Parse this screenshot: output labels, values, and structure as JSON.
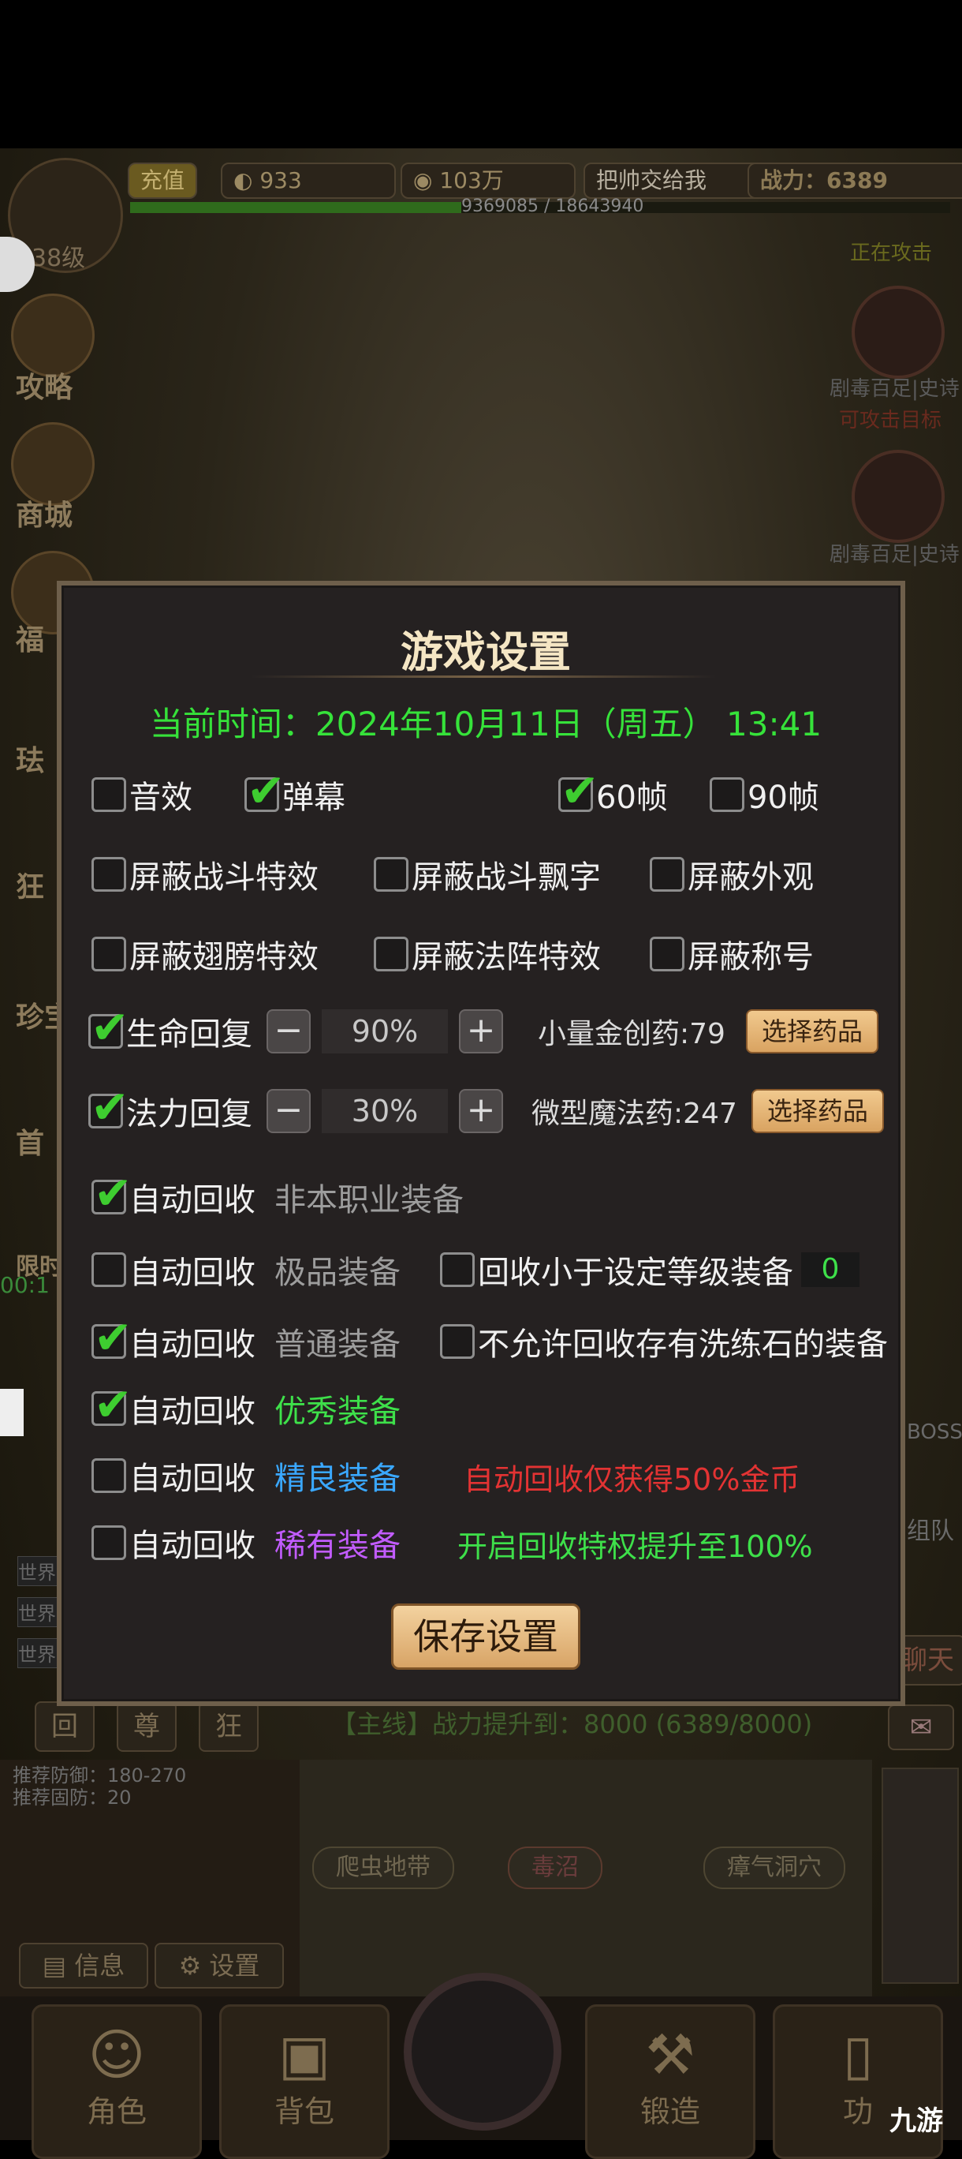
{
  "hud": {
    "charge_label": "充值",
    "gold": "933",
    "coins": "103万",
    "player_name": "把帅交给我",
    "power_label": "战力：6389",
    "exp_text": "9369085 / 18643940",
    "level": "38级",
    "attacking": "正在攻击",
    "attackable": "可攻击目标",
    "enemy1": "剧毒百足|史诗",
    "enemy2": "剧毒百足|史诗",
    "boss_label": "BOSS",
    "team_label": "组队",
    "chat_label": "聊天"
  },
  "side_menu": [
    "攻略",
    "商城",
    "福",
    "珐",
    "狂",
    "珍宝",
    "首",
    "限时"
  ],
  "side_timer": "00:1",
  "chat_tabs": [
    "世界",
    "世界",
    "世界"
  ],
  "quest": {
    "tabs": [
      "回",
      "尊",
      "狂"
    ],
    "main_quest": "【主线】战力提升到：8000 (6389/8000)"
  },
  "map": {
    "rec_defense": "推荐防御：180-270",
    "rec_solid": "推荐固防：20",
    "nodes": [
      "爬虫地带",
      "毒沼",
      "瘴气洞穴"
    ],
    "info_button": "信息",
    "settings_button": "设置"
  },
  "bottom_nav": [
    "角色",
    "背包",
    "锻造",
    "功"
  ],
  "watermark": "九游",
  "settings": {
    "title": "游戏设置",
    "current_time": "当前时间：2024年10月11日（周五） 13:41",
    "sound": {
      "label": "音效",
      "checked": false
    },
    "barrage": {
      "label": "弹幕",
      "checked": true
    },
    "fps60": {
      "label": "60帧",
      "checked": true
    },
    "fps90": {
      "label": "90帧",
      "checked": false
    },
    "block_battle_fx": {
      "label": "屏蔽战斗特效",
      "checked": false
    },
    "block_battle_text": {
      "label": "屏蔽战斗飘字",
      "checked": false
    },
    "block_appearance": {
      "label": "屏蔽外观",
      "checked": false
    },
    "block_wing_fx": {
      "label": "屏蔽翅膀特效",
      "checked": false
    },
    "block_array_fx": {
      "label": "屏蔽法阵特效",
      "checked": false
    },
    "block_title": {
      "label": "屏蔽称号",
      "checked": false
    },
    "hp_recover": {
      "label": "生命回复",
      "checked": true,
      "value": "90%",
      "potion": "小量金创药:79",
      "button": "选择药品"
    },
    "mp_recover": {
      "label": "法力回复",
      "checked": true,
      "value": "30%",
      "potion": "微型魔法药:247",
      "button": "选择药品"
    },
    "recycle_label": "自动回收",
    "recycle_nonclass": {
      "desc": "非本职业装备",
      "checked": true
    },
    "recycle_top": {
      "desc": "极品装备",
      "checked": false
    },
    "recycle_below_level": {
      "label": "回收小于设定等级装备",
      "value": "0",
      "checked": false
    },
    "recycle_normal": {
      "desc": "普通装备",
      "checked": true
    },
    "no_recycle_wash": {
      "label": "不允许回收存有洗练石的装备",
      "checked": false
    },
    "recycle_good": {
      "desc": "优秀装备",
      "checked": true
    },
    "recycle_fine": {
      "desc": "精良装备",
      "checked": false
    },
    "recycle_rare": {
      "desc": "稀有装备",
      "checked": false
    },
    "note_half_gold": "自动回收仅获得50%金币",
    "note_privilege": "开启回收特权提升至100%",
    "save_button": "保存设置"
  }
}
